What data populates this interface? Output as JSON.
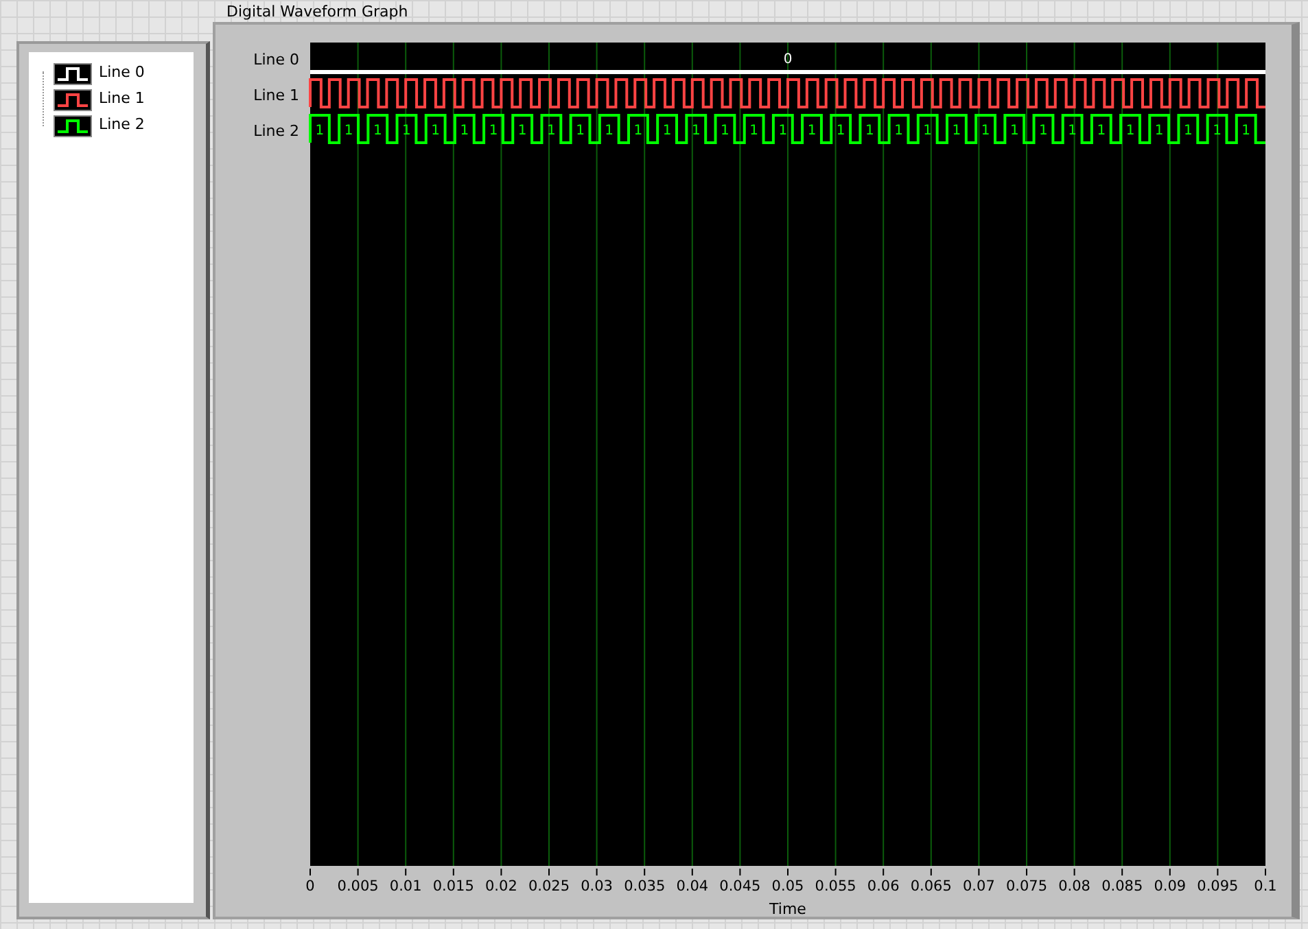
{
  "title": "Digital Waveform Graph",
  "legend": [
    {
      "label": "Line 0",
      "color": "#ffffff"
    },
    {
      "label": "Line 1",
      "color": "#ff4444"
    },
    {
      "label": "Line 2",
      "color": "#00ff00"
    }
  ],
  "graph": {
    "lines": [
      {
        "name": "Line 0",
        "color": "#ffffff",
        "kind": "constant",
        "bit_labels": [
          "0"
        ]
      },
      {
        "name": "Line 1",
        "color": "#ff4444",
        "kind": "fast"
      },
      {
        "name": "Line 2",
        "color": "#00ff00",
        "kind": "slow",
        "bit_labels": [
          "1",
          "1",
          "1",
          "1",
          "1",
          "1",
          "1",
          "1",
          "1",
          "1",
          "1",
          "1",
          "1",
          "1",
          "1",
          "1",
          "1",
          "1",
          "1",
          "1",
          "1",
          "1",
          "1",
          "1",
          "1",
          "1",
          "1",
          "1",
          "1",
          "1",
          "1",
          "1",
          "1"
        ]
      }
    ],
    "xticks": [
      "0",
      "0.005",
      "0.01",
      "0.015",
      "0.02",
      "0.025",
      "0.03",
      "0.035",
      "0.04",
      "0.045",
      "0.05",
      "0.055",
      "0.06",
      "0.065",
      "0.07",
      "0.075",
      "0.08",
      "0.085",
      "0.09",
      "0.095",
      "0.1"
    ],
    "xlabel": "Time"
  }
}
